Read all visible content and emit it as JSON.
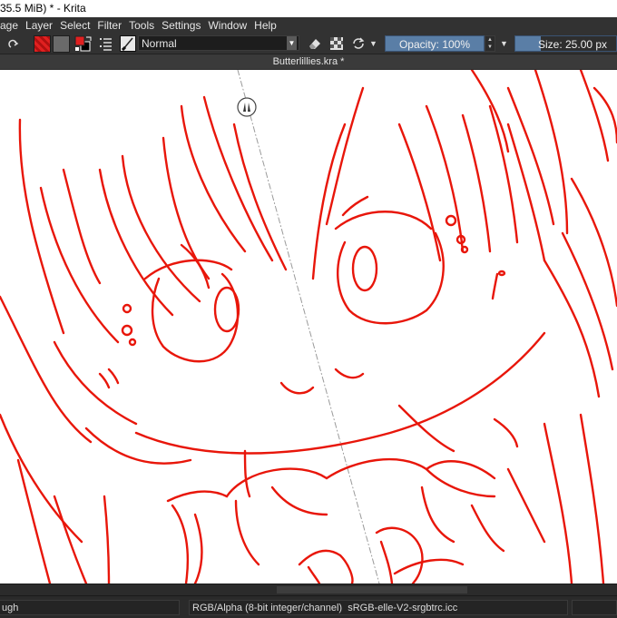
{
  "window": {
    "title": "35.5 MiB)  * - Krita"
  },
  "menu": {
    "items": [
      "age",
      "Layer",
      "Select",
      "Filter",
      "Tools",
      "Settings",
      "Window",
      "Help"
    ]
  },
  "toolbar": {
    "blend_mode": "Normal",
    "opacity_label": "Opacity: 100%",
    "size_label": "Size: 25.00 px",
    "foreground_color": "#e02020",
    "background_color": "#000000"
  },
  "document": {
    "tab_title": "Butterlillies.kra *"
  },
  "canvas": {
    "line_color": "#e8160a",
    "background": "#ffffff"
  },
  "status": {
    "brush_name": "ugh",
    "color_space": "RGB/Alpha (8-bit integer/channel)",
    "color_profile": "sRGB-elle-V2-srgbtrc.icc"
  }
}
